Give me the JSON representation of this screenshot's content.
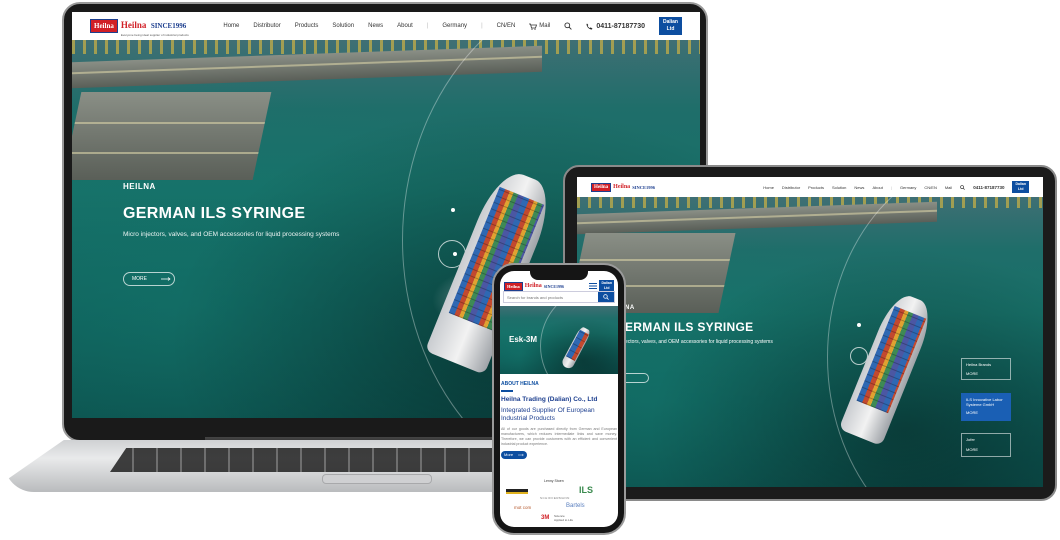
{
  "brand": {
    "logo_mark": "Heilna",
    "name": "Heilna",
    "since": "SINCE1996",
    "tagline": "Everyone being ideal supplier of industrial products"
  },
  "nav": {
    "items": [
      "Home",
      "Distributor",
      "Products",
      "Solution",
      "News",
      "About"
    ],
    "region": "Germany",
    "lang": "CN/EN",
    "mail": "Mail",
    "phone": "0411-87187730",
    "dalian_line1": "Dalian",
    "dalian_line2": "Ltd"
  },
  "hero": {
    "kicker": "HEILNA",
    "title": "GERMAN ILS SYRINGE",
    "subtitle": "Micro injectors, valves, and OEM accessories for liquid processing systems",
    "more": "MORE",
    "tablet_kicker": "NA",
    "tablet_title": "ERMAN ILS SYRINGE",
    "tablet_subtitle": "ectors, valves, and OEM accessories for liquid processing systems"
  },
  "tablet_cards": [
    {
      "title": "Heilna Brands",
      "more": "MORE"
    },
    {
      "title": "ILS Innovative Labor Systeme GmbH",
      "more": "MORE"
    },
    {
      "title": "Jofer",
      "more": "MORE"
    }
  ],
  "phone": {
    "search_placeholder": "Search for brands and products",
    "hero_label": "Esk-3M",
    "about_kicker": "ABOUT HEILNA",
    "company": "Heilna Trading (Dalian) Co., Ltd",
    "headline": "Integrated Supplier Of European Industrial Products",
    "body": "All of our goods are purchased directly from German and European manufacturers, which reduces intermediate links and save money. Therefore, we can provide customers with an efficient and convenient industrial product experience.",
    "more": "More",
    "brands": [
      "Lenny Stoen",
      "ILS",
      "SCHIFFERMANN",
      "Bartels",
      "mot com",
      "3M",
      "Science Applied to Life"
    ]
  },
  "colors": {
    "brand_blue": "#0d4ea0",
    "brand_red": "#d11f26",
    "heading_blue": "#1d3f8f"
  },
  "icons": {
    "mail": "cart-icon",
    "search": "search-icon",
    "phone": "phone-icon",
    "menu": "hamburger-icon",
    "arrow": "arrow-right-icon"
  }
}
